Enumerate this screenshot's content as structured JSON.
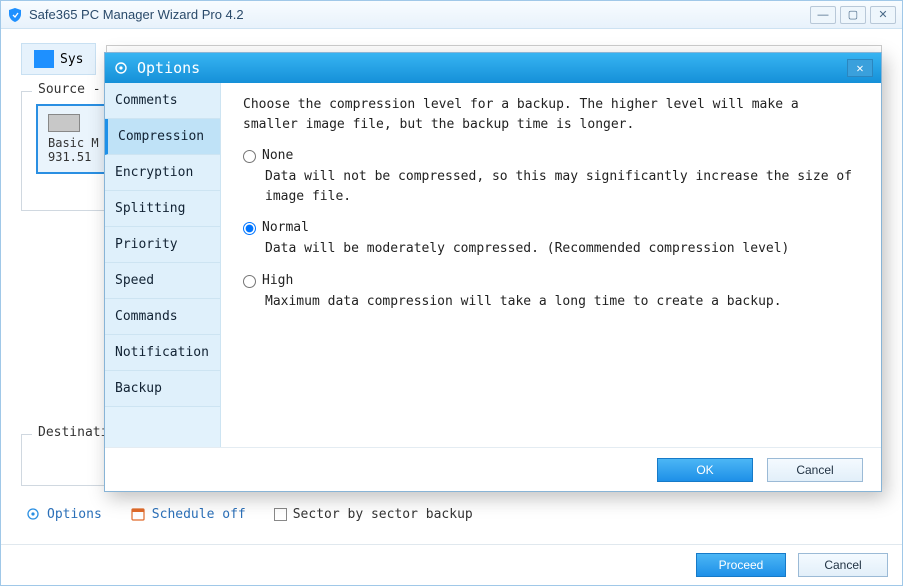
{
  "window": {
    "title": "Safe365 PC Manager Wizard Pro 4.2",
    "controls": {
      "min": "—",
      "max": "▢",
      "close": "✕"
    }
  },
  "toolbar": {
    "tab_label": "Sys"
  },
  "source": {
    "legend": "Source -",
    "disk_name": "Basic M",
    "disk_size": "931.51"
  },
  "destination": {
    "legend": "Destinati"
  },
  "bottom": {
    "options": "Options",
    "schedule": "Schedule off",
    "sector": "Sector by sector backup"
  },
  "footer": {
    "proceed": "Proceed",
    "cancel": "Cancel"
  },
  "dialog": {
    "title": "Options",
    "sidebar": [
      "Comments",
      "Compression",
      "Encryption",
      "Splitting",
      "Priority",
      "Speed",
      "Commands",
      "Notification",
      "Backup"
    ],
    "active_index": 1,
    "intro": "Choose the compression level for a backup. The higher level will make a smaller image file, but the backup time is longer.",
    "opts": {
      "none": {
        "label": "None",
        "desc": "Data will not be compressed, so this may significantly increase the size of image file."
      },
      "normal": {
        "label": "Normal",
        "desc": "Data will be moderately compressed. (Recommended compression level)"
      },
      "high": {
        "label": "High",
        "desc": "Maximum data compression will take a long time to create a backup."
      }
    },
    "selected": "normal",
    "ok": "OK",
    "cancel": "Cancel"
  }
}
